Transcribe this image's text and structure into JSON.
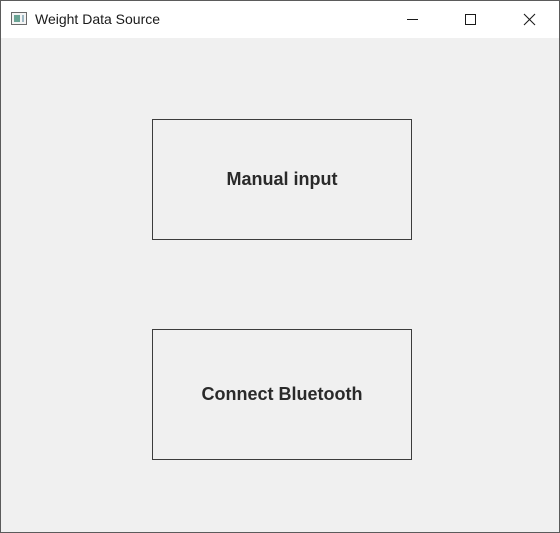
{
  "window": {
    "title": "Weight Data Source",
    "background_color": "#f0f0f0",
    "titlebar_color": "#ffffff",
    "icon": "app-window-icon"
  },
  "caption_buttons": {
    "minimize_icon": "minimize-icon",
    "maximize_icon": "maximize-icon",
    "close_icon": "close-icon"
  },
  "actions": {
    "manual_input_label": "Manual input",
    "connect_bluetooth_label": "Connect Bluetooth"
  }
}
